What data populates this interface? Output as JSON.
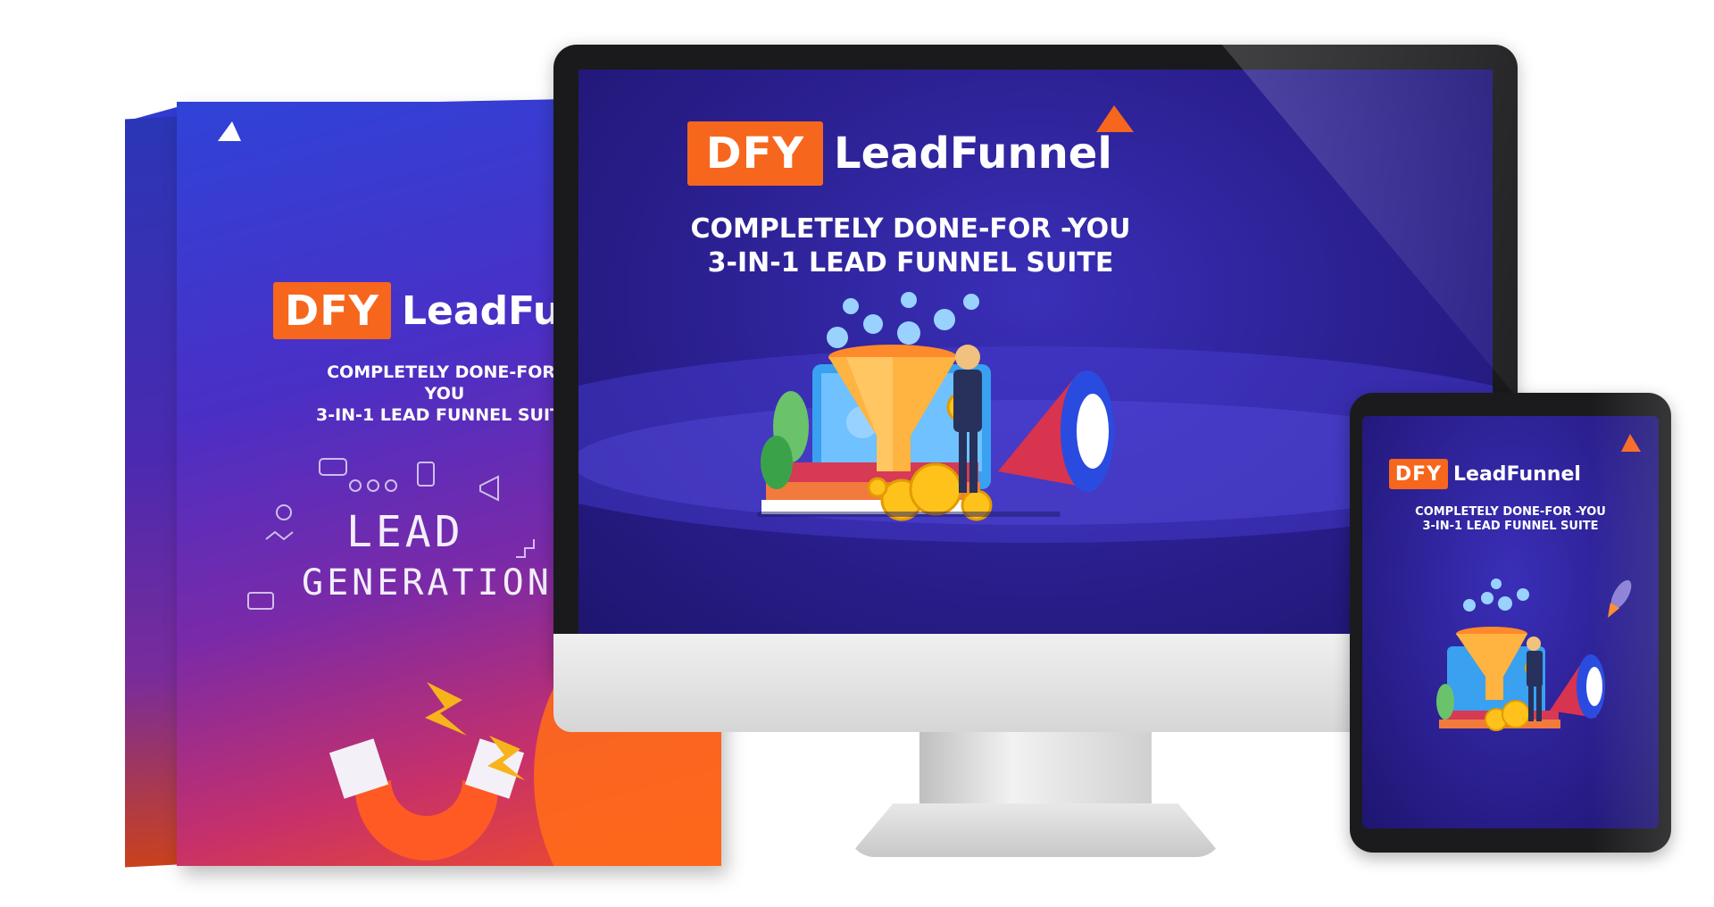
{
  "brand": {
    "prefix": "DFY",
    "name": "LeadFunnel",
    "accent_color": "#f7661d"
  },
  "box": {
    "tagline_line1": "COMPLETELY DONE-FOR-YOU",
    "tagline_line2": "3-IN-1 LEAD FUNNEL SUITE",
    "art_word1": "LEAD",
    "art_word2": "GENERATION",
    "icons": [
      "like-icon",
      "chat-icon",
      "megaphone-icon",
      "phone-icon",
      "bulb-icon",
      "chart-icon",
      "magnet-icon",
      "lightning-icon"
    ]
  },
  "monitor": {
    "tagline_line1": "COMPLETELY DONE-FOR -YOU",
    "tagline_line2": "3-IN-1 LEAD FUNNEL SUITE",
    "icons": [
      "funnel-icon",
      "user-bubble-icon",
      "megaphone-icon",
      "coin-icon",
      "businessman-icon",
      "gear-icon"
    ]
  },
  "tablet": {
    "tagline_line1": "COMPLETELY DONE-FOR -YOU",
    "tagline_line2": "3-IN-1 LEAD FUNNEL SUITE",
    "icons": [
      "funnel-icon",
      "user-bubble-icon",
      "megaphone-icon",
      "coin-icon",
      "rocket-icon"
    ]
  }
}
